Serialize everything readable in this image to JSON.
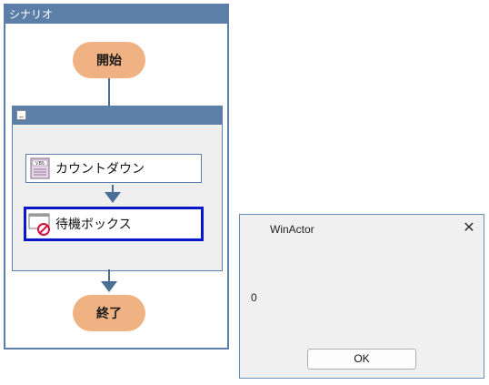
{
  "scenario": {
    "title": "シナリオ",
    "start_label": "開始",
    "end_label": "終了",
    "actions": [
      {
        "label": "カウントダウン",
        "icon": "vbs-script-icon"
      },
      {
        "label": "待機ボックス",
        "icon": "wait-box-icon"
      }
    ]
  },
  "dialog": {
    "title": "WinActor",
    "message": "0",
    "ok_label": "OK",
    "close_icon": "close-icon"
  },
  "colors": {
    "panel_border": "#5b7fa8",
    "terminal_fill": "#f1b283",
    "selected_border": "#0a17c9"
  }
}
